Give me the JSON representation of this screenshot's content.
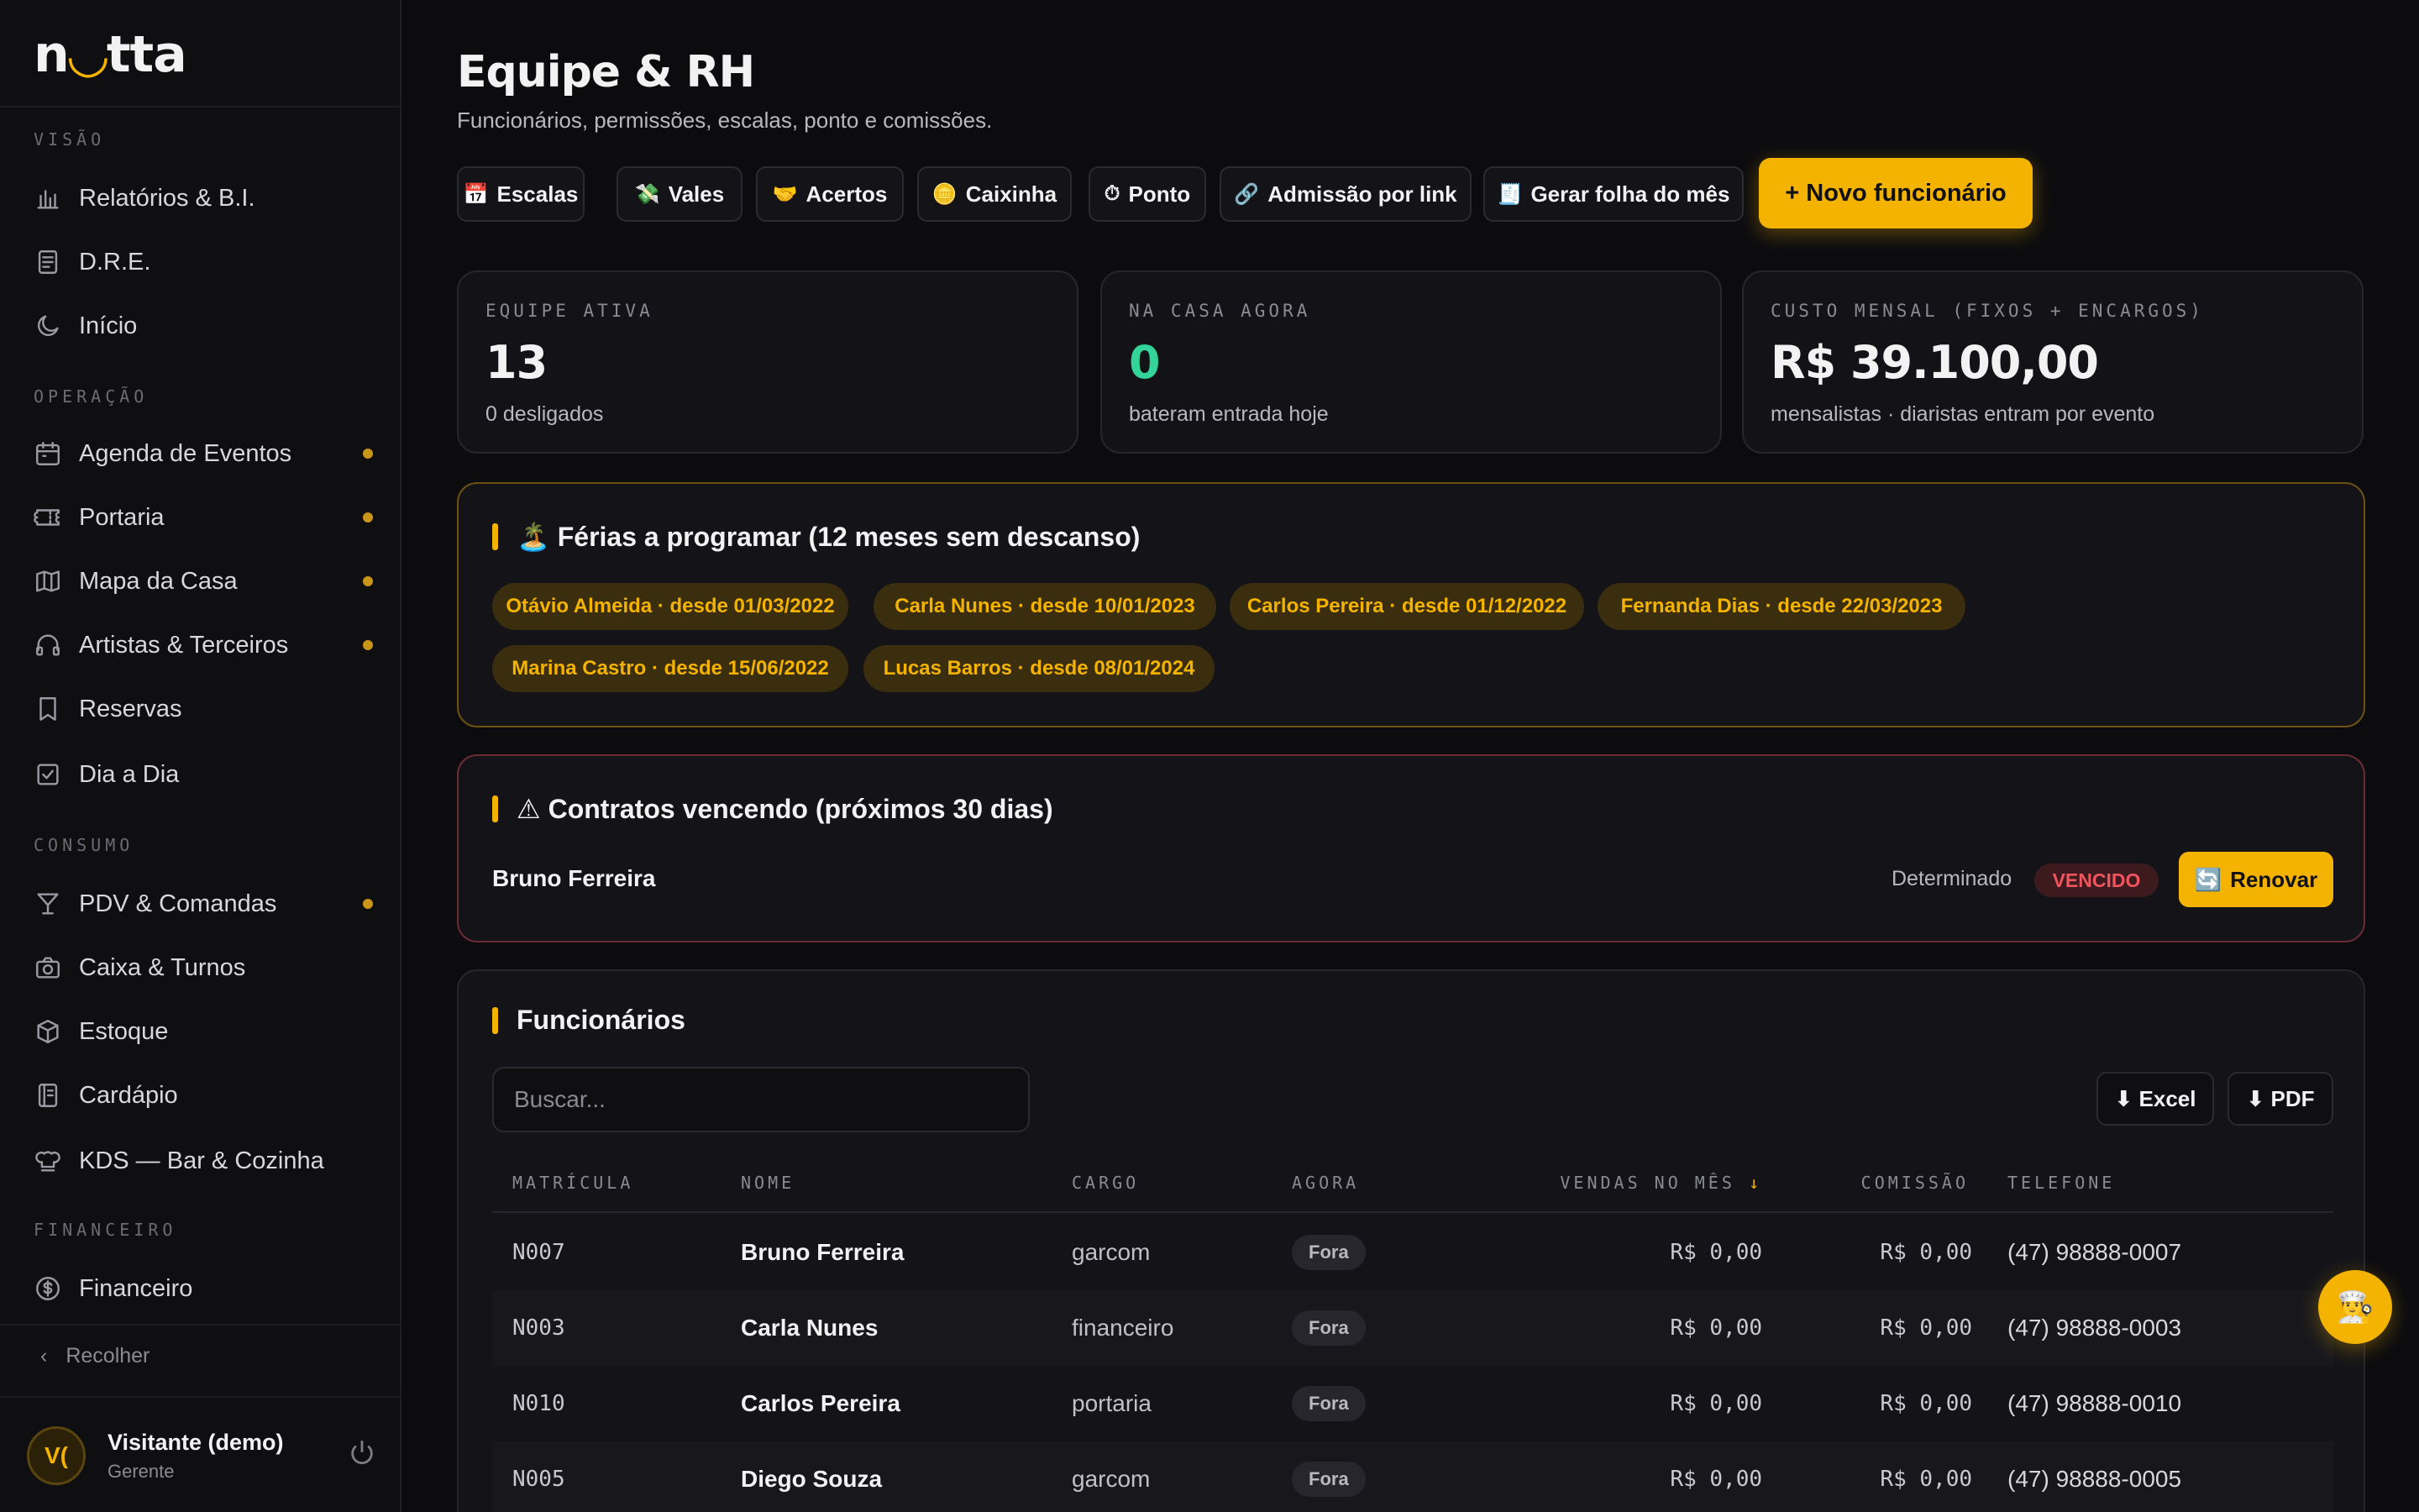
{
  "brand": {
    "logo_pre": "n",
    "logo_moon": "◡",
    "logo_post": "tta"
  },
  "sidebar": {
    "sections": {
      "visao": "VISÃO",
      "operacao": "OPERAÇÃO",
      "consumo": "CONSUMO",
      "financeiro": "FINANCEIRO"
    },
    "items": [
      {
        "label": "Relatórios & B.I.",
        "icon": "bar-chart-icon",
        "dot": false
      },
      {
        "label": "D.R.E.",
        "icon": "document-icon",
        "dot": false
      },
      {
        "label": "Início",
        "icon": "moon-icon",
        "dot": false
      },
      {
        "label": "Agenda de Eventos",
        "icon": "calendar-icon",
        "dot": true
      },
      {
        "label": "Portaria",
        "icon": "ticket-icon",
        "dot": true
      },
      {
        "label": "Mapa da Casa",
        "icon": "map-icon",
        "dot": true
      },
      {
        "label": "Artistas & Terceiros",
        "icon": "headphones-icon",
        "dot": true
      },
      {
        "label": "Reservas",
        "icon": "bookmark-icon",
        "dot": false
      },
      {
        "label": "Dia a Dia",
        "icon": "checkbox-icon",
        "dot": false
      },
      {
        "label": "PDV & Comandas",
        "icon": "cocktail-icon",
        "dot": true
      },
      {
        "label": "Caixa & Turnos",
        "icon": "camera-icon",
        "dot": false
      },
      {
        "label": "Estoque",
        "icon": "box-icon",
        "dot": false
      },
      {
        "label": "Cardápio",
        "icon": "menu-book-icon",
        "dot": false
      },
      {
        "label": "KDS — Bar & Cozinha",
        "icon": "chef-hat-icon",
        "dot": false
      },
      {
        "label": "Financeiro",
        "icon": "dollar-icon",
        "dot": false
      }
    ],
    "collapse_label": "Recolher",
    "user": {
      "initials": "V(",
      "name": "Visitante (demo)",
      "role": "Gerente"
    }
  },
  "header": {
    "title": "Equipe & RH",
    "subtitle": "Funcionários, permissões, escalas, ponto e comissões."
  },
  "actions": [
    {
      "emoji": "📅",
      "label": "Escalas"
    },
    {
      "emoji": "💸",
      "label": "Vales"
    },
    {
      "emoji": "🤝",
      "label": "Acertos"
    },
    {
      "emoji": "🪙",
      "label": "Caixinha"
    },
    {
      "emoji": "⏱",
      "label": "Ponto"
    },
    {
      "emoji": "🔗",
      "label": "Admissão por link"
    },
    {
      "emoji": "🧾",
      "label": "Gerar folha do mês"
    }
  ],
  "primary_action": "+ Novo funcionário",
  "stats": [
    {
      "label": "EQUIPE ATIVA",
      "value": "13",
      "note": "0 desligados",
      "color": "#f2f2f3"
    },
    {
      "label": "NA CASA AGORA",
      "value": "0",
      "note": "bateram entrada hoje",
      "color": "#34d399"
    },
    {
      "label": "CUSTO MENSAL (FIXOS + ENCARGOS)",
      "value": "R$ 39.100,00",
      "note": "mensalistas · diaristas entram por evento",
      "color": "#f2f2f3"
    }
  ],
  "ferias": {
    "title": "🏝️ Férias a programar (12 meses sem descanso)",
    "pills": [
      "Otávio Almeida · desde 01/03/2022",
      "Carla Nunes · desde 10/01/2023",
      "Carlos Pereira · desde 01/12/2022",
      "Fernanda Dias · desde 22/03/2023",
      "Marina Castro · desde 15/06/2022",
      "Lucas Barros · desde 08/01/2024"
    ]
  },
  "contratos": {
    "title": "⚠ Contratos vencendo (próximos 30 dias)",
    "name": "Bruno Ferreira",
    "type": "Determinado",
    "status": "VENCIDO",
    "renew_emoji": "🔄",
    "renew_label": "Renovar"
  },
  "funcionarios": {
    "title": "Funcionários",
    "search_placeholder": "Buscar...",
    "export_excel": "⬇ Excel",
    "export_pdf": "⬇ PDF",
    "columns": {
      "mat": "MATRÍCULA",
      "nome": "NOME",
      "cargo": "CARGO",
      "agora": "AGORA",
      "vendas": "VENDAS NO MÊS",
      "sort_arrow": "↓",
      "comissao": "COMISSÃO",
      "telefone": "TELEFONE"
    },
    "rows": [
      {
        "mat": "N007",
        "nome": "Bruno Ferreira",
        "cargo": "garcom",
        "agora": "Fora",
        "vendas": "R$ 0,00",
        "comissao": "R$ 0,00",
        "telefone": "(47) 98888-0007"
      },
      {
        "mat": "N003",
        "nome": "Carla Nunes",
        "cargo": "financeiro",
        "agora": "Fora",
        "vendas": "R$ 0,00",
        "comissao": "R$ 0,00",
        "telefone": "(47) 98888-0003"
      },
      {
        "mat": "N010",
        "nome": "Carlos Pereira",
        "cargo": "portaria",
        "agora": "Fora",
        "vendas": "R$ 0,00",
        "comissao": "R$ 0,00",
        "telefone": "(47) 98888-0010"
      },
      {
        "mat": "N005",
        "nome": "Diego Souza",
        "cargo": "garcom",
        "agora": "Fora",
        "vendas": "R$ 0,00",
        "comissao": "R$ 0,00",
        "telefone": "(47) 98888-0005"
      }
    ]
  },
  "fab_emoji": "👨‍🍳",
  "colors": {
    "accent": "#f5b301",
    "success": "#34d399",
    "danger": "#f0555f",
    "background": "#0c0c0f"
  }
}
